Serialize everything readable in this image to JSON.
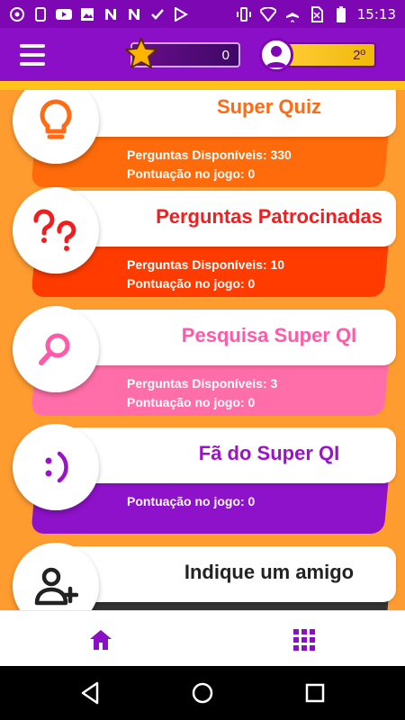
{
  "status_bar": {
    "time": "15:13",
    "icons": [
      "chrome-icon",
      "phone-sync-icon",
      "youtube-icon",
      "gallery-icon",
      "n-icon",
      "n-icon",
      "check-icon",
      "play-store-icon",
      "vibrate-icon",
      "wifi-icon",
      "airplane-icon",
      "no-sim-icon",
      "battery-icon"
    ]
  },
  "header": {
    "score": "0",
    "rank": "2º"
  },
  "cards": [
    {
      "id": "super-quiz",
      "title": "Super Quiz",
      "title_color": "#ff6a13",
      "base_color": "#ff6a0a",
      "icon": "lightbulb-icon",
      "stats": [
        "Perguntas Disponíveis: 330",
        "Pontuação no jogo: 0"
      ]
    },
    {
      "id": "patrocinadas",
      "title": "Perguntas Patrocinadas",
      "title_color": "#f01e1e",
      "base_color": "#ff3b00",
      "icon": "question-marks-icon",
      "stats": [
        "Perguntas Disponíveis: 10",
        "Pontuação no jogo: 0"
      ]
    },
    {
      "id": "pesquisa",
      "title": "Pesquisa Super QI",
      "title_color": "#ff5aa8",
      "base_color": "#ff6ea8",
      "icon": "magnifier-icon",
      "stats": [
        "Perguntas Disponíveis: 3",
        "Pontuação no jogo: 0"
      ]
    },
    {
      "id": "fa",
      "title": "Fã do Super QI",
      "title_color": "#9c12c9",
      "base_color": "#8e12c9",
      "icon": "smiley-icon",
      "stats": [
        "",
        "Pontuação no jogo: 0"
      ]
    },
    {
      "id": "indique",
      "title": "Indique um amigo",
      "title_color": "#222222",
      "base_color": "#333333",
      "icon": "add-user-icon",
      "stats": [
        "",
        ""
      ]
    }
  ],
  "colors": {
    "primary": "#8b0fc7",
    "background": "#ff9c30",
    "accent_strip": "#ffc21a"
  }
}
